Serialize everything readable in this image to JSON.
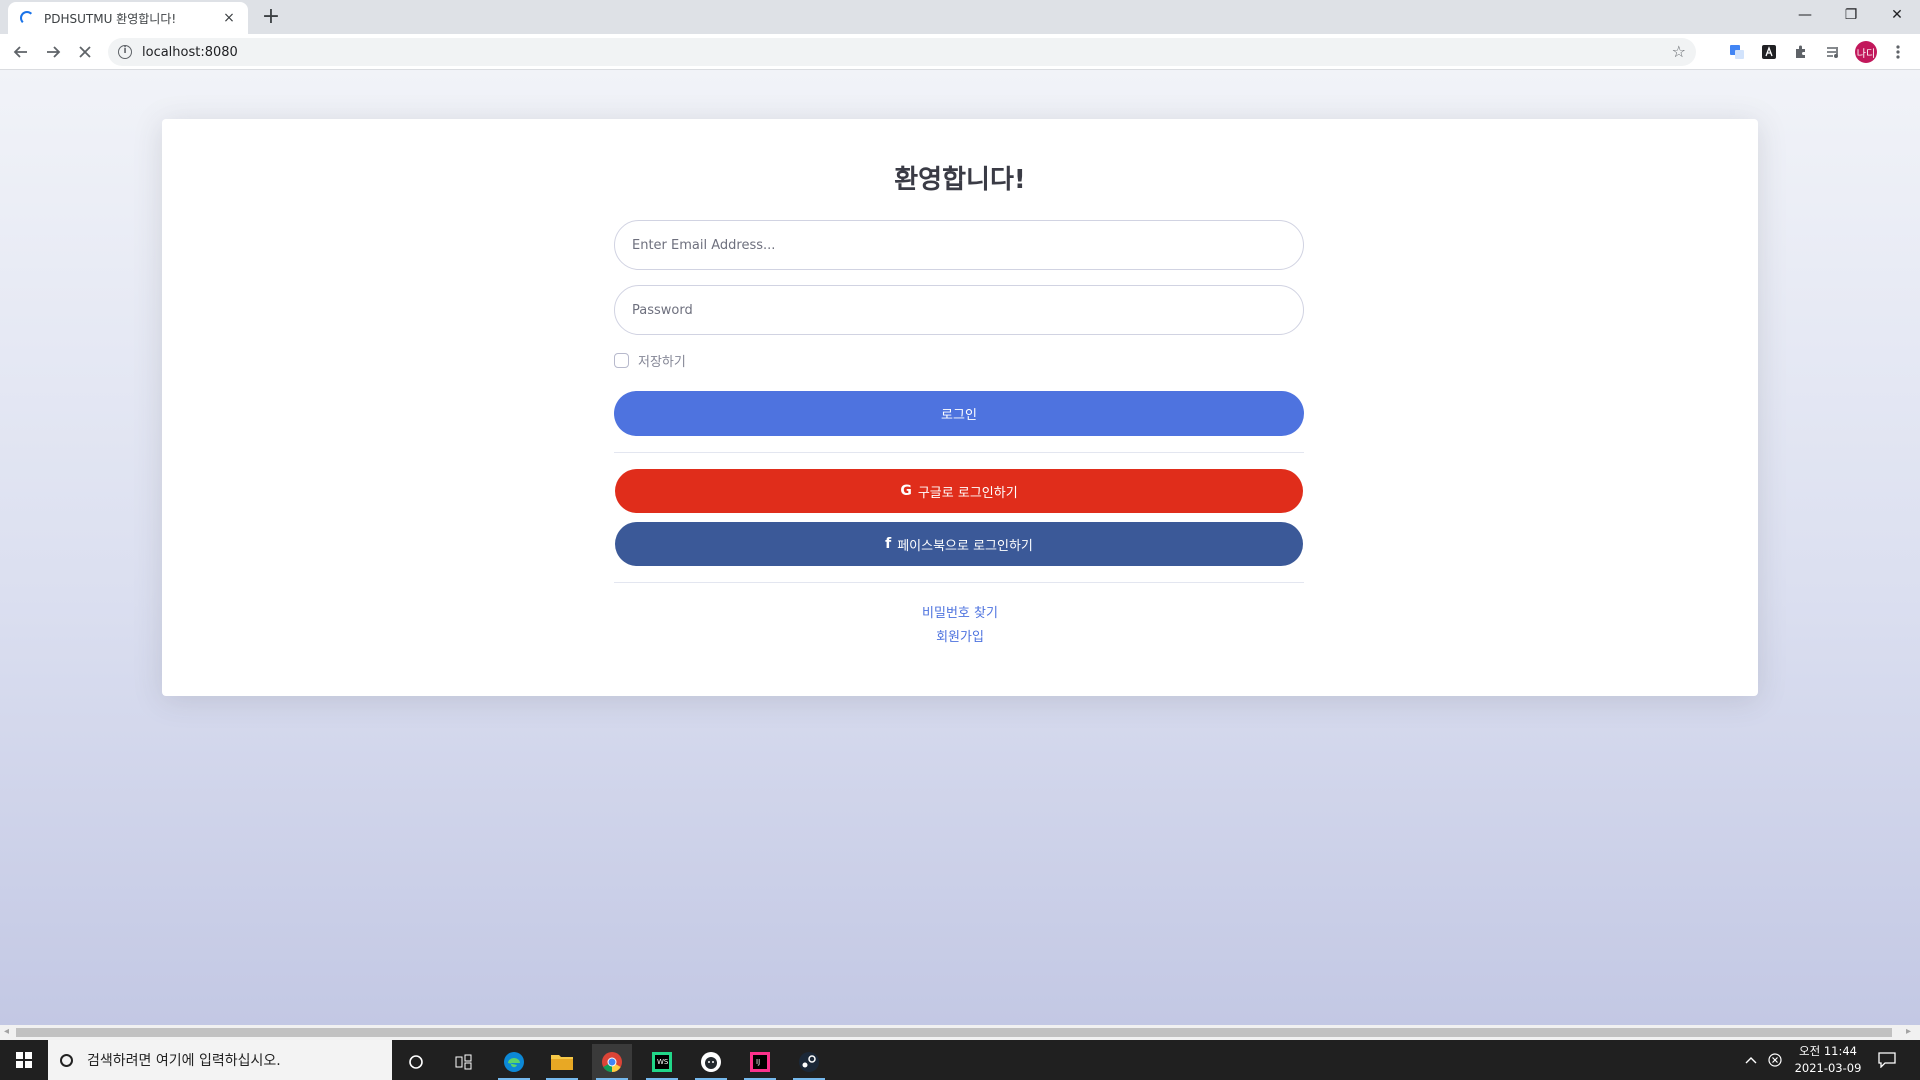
{
  "browser": {
    "tab_title": "PDHSUTMU 환영합니다!",
    "tab_close": "×",
    "new_tab": "+",
    "url": "localhost:8080",
    "profile_initials": "나디",
    "window_controls": {
      "minimize": "—",
      "maximize": "❐",
      "close": "✕"
    }
  },
  "login": {
    "heading": "환영합니다!",
    "email_placeholder": "Enter Email Address...",
    "password_placeholder": "Password",
    "remember_label": "저장하기",
    "login_button": "로그인",
    "google_button": "구글로 로그인하기",
    "facebook_button": "페이스북으로 로그인하기",
    "forgot_password_link": "비밀번호 찾기",
    "register_link": "회원가입"
  },
  "taskbar": {
    "search_placeholder": "검색하려면 여기에 입력하십시오.",
    "clock_time": "오전 11:44",
    "clock_date": "2021-03-09",
    "pinned_apps": [
      "cortana",
      "task-view",
      "edge",
      "file-explorer",
      "chrome",
      "webstorm",
      "github-desktop",
      "intellij",
      "steam"
    ]
  },
  "colors": {
    "primary": "#4e73df",
    "google": "#e02d1b",
    "facebook": "#3b5998",
    "taskbar": "#202020"
  }
}
